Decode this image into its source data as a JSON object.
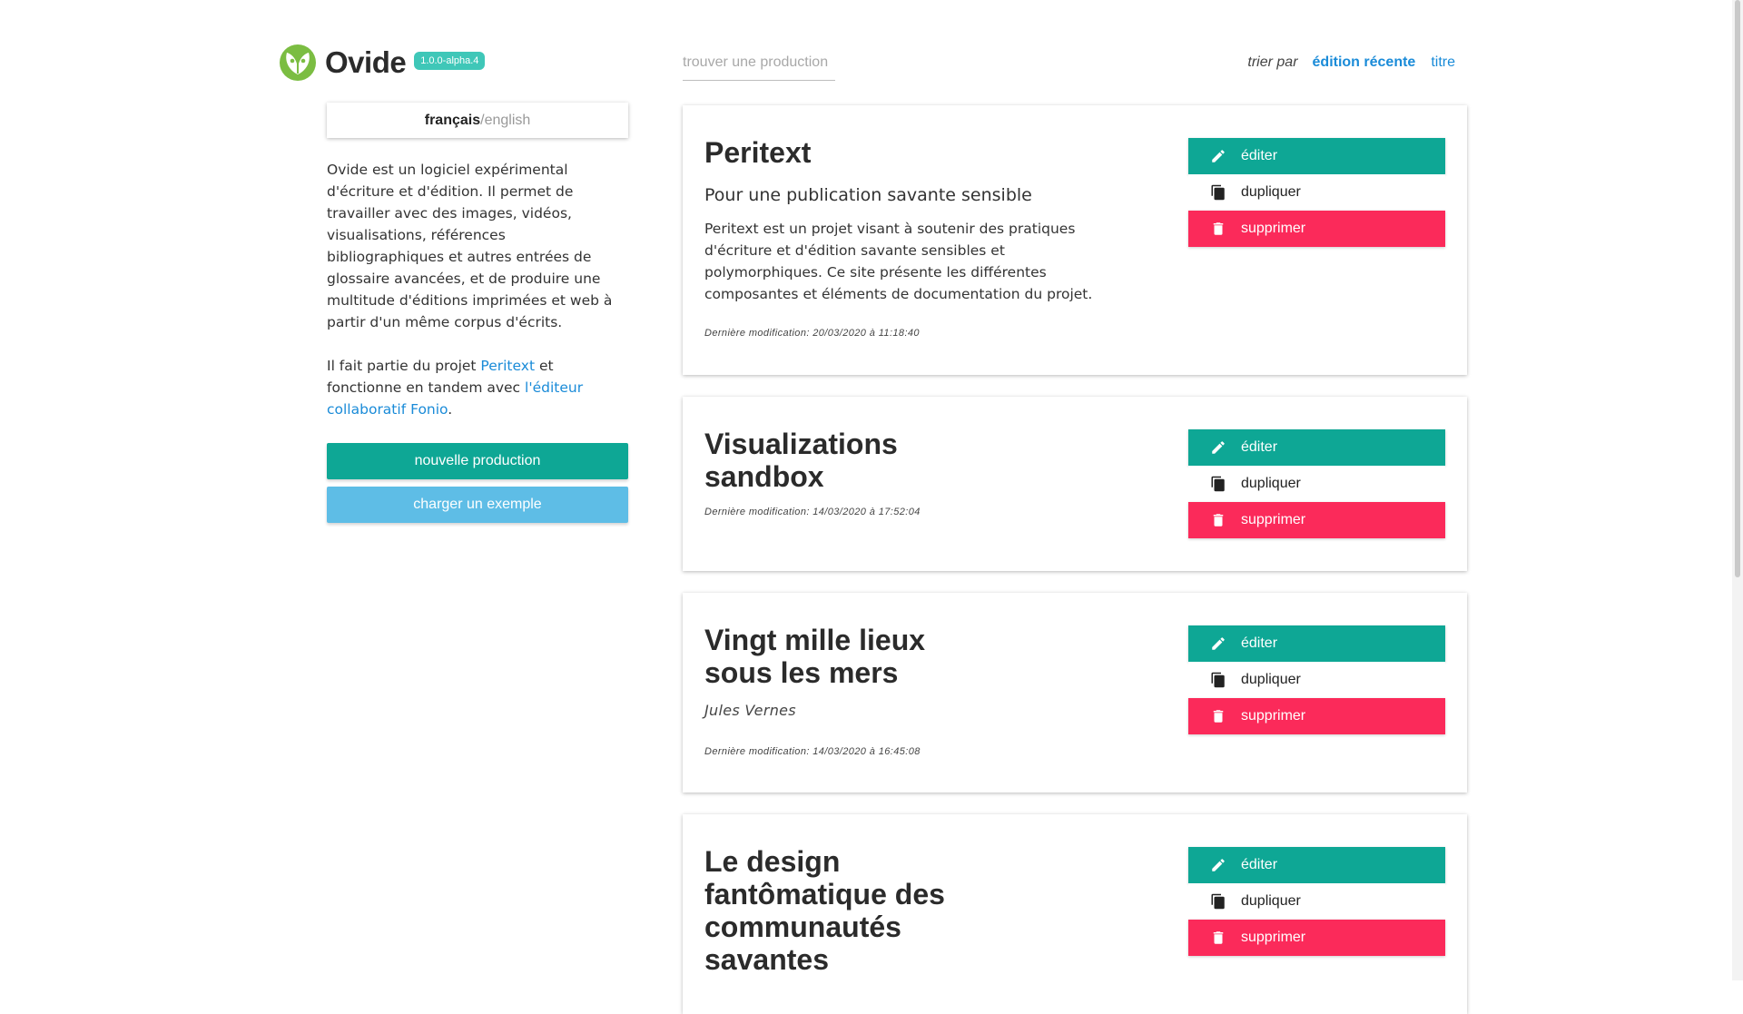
{
  "app": {
    "title": "Ovide",
    "version": "1.0.0-alpha.4",
    "logo_icon": "butterfly-leaf-logo",
    "brand_color": "#7bbd42"
  },
  "language": {
    "active": "français",
    "separator": "/",
    "other": "english"
  },
  "intro": {
    "paragraph1": "Ovide est un logiciel expérimental d'écriture et d'édition. Il permet de travailler avec des images, vidéos, visualisations, références bibliographiques et autres entrées de glossaire avancées, et de produire une multitude d'éditions imprimées et web à partir d'un même corpus d'écrits.",
    "p2_before": "Il fait partie du projet ",
    "p2_link1": "Peritext",
    "p2_middle": " et fonctionne en tandem avec ",
    "p2_link2": "l'éditeur collaboratif Fonio",
    "p2_after": "."
  },
  "buttons": {
    "new_production": "nouvelle production",
    "load_example": "charger un exemple"
  },
  "search": {
    "placeholder": "trouver une production",
    "value": ""
  },
  "sort": {
    "label": "trier par",
    "options": [
      "édition récente",
      "titre"
    ],
    "active": "édition récente"
  },
  "actions": {
    "edit": "éditer",
    "duplicate": "dupliquer",
    "delete": "supprimer"
  },
  "colors": {
    "teal": "#0ea795",
    "red": "#fb2a5a",
    "light_blue": "#5ebde6",
    "link": "#1a8bd8"
  },
  "productions": [
    {
      "title": "Peritext",
      "subtitle": "Pour une publication savante sensible",
      "description": "Peritext est un projet visant à soutenir des pratiques d'écriture et d'édition savante sensibles et polymorphiques. Ce site présente les différentes composantes et éléments de documentation du projet.",
      "author": "",
      "modified": "Dernière modification: 20/03/2020 à 11:18:40"
    },
    {
      "title": "Visualizations sandbox",
      "subtitle": "",
      "description": "",
      "author": "",
      "modified": "Dernière modification: 14/03/2020 à 17:52:04"
    },
    {
      "title": "Vingt mille lieux sous les mers",
      "subtitle": "",
      "description": "",
      "author": "Jules Vernes",
      "modified": "Dernière modification: 14/03/2020 à 16:45:08"
    },
    {
      "title": "Le design fantômatique des communautés savantes",
      "subtitle": "",
      "description": "",
      "author": "",
      "modified": ""
    }
  ]
}
